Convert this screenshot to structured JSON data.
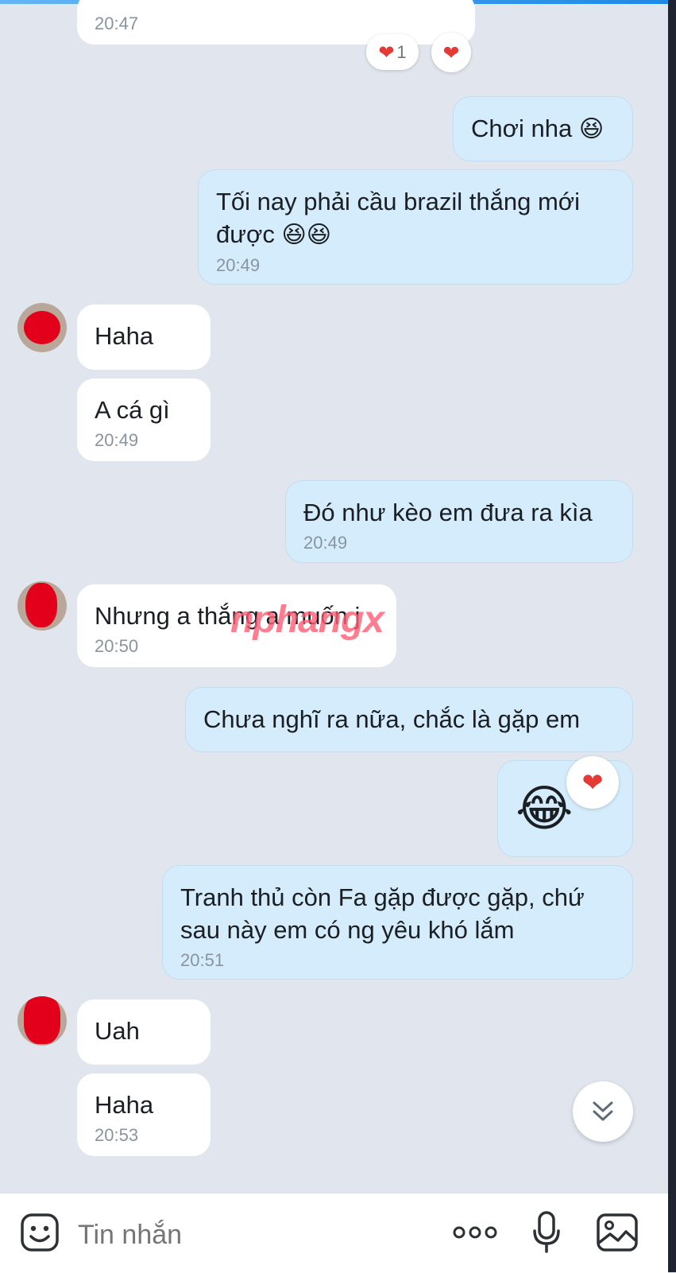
{
  "messages": [
    {
      "text": "",
      "time": "20:47"
    },
    {
      "text": "Chơi nha",
      "emoji": "😆"
    },
    {
      "text": "Tối nay phải cầu brazil thắng mới",
      "text2": "được",
      "emoji": "😆😆",
      "time": "20:49"
    },
    {
      "text": "Haha"
    },
    {
      "text": "A cá gì",
      "time": "20:49"
    },
    {
      "text": "Đó như kèo em đưa ra kìa",
      "time": "20:49"
    },
    {
      "text": "Nhưng a thắng a muốn j",
      "time": "20:50"
    },
    {
      "text": "Chưa nghĩ ra nữa, chắc là gặp em"
    },
    {
      "emoji": "😂"
    },
    {
      "text": "Tranh thủ còn Fa gặp được gặp, chứ",
      "text2": "sau này em có ng yêu khó lắm",
      "time": "20:51"
    },
    {
      "text": "Uah"
    },
    {
      "text": "Haha",
      "time": "20:53"
    }
  ],
  "reactions": {
    "heart_count": "1",
    "heart_icon": "heart-icon"
  },
  "watermark": "nphangx",
  "input": {
    "placeholder": "Tin nhắn"
  },
  "icons": {
    "sticker": "sticker-face-icon",
    "more": "more-dots-icon",
    "mic": "microphone-icon",
    "image": "image-icon",
    "scroll": "double-chevron-down-icon"
  },
  "colors": {
    "incoming": "#ffffff",
    "outgoing": "#d4ecfb",
    "background": "#e1e6ee",
    "accent": "#1e88e5"
  }
}
